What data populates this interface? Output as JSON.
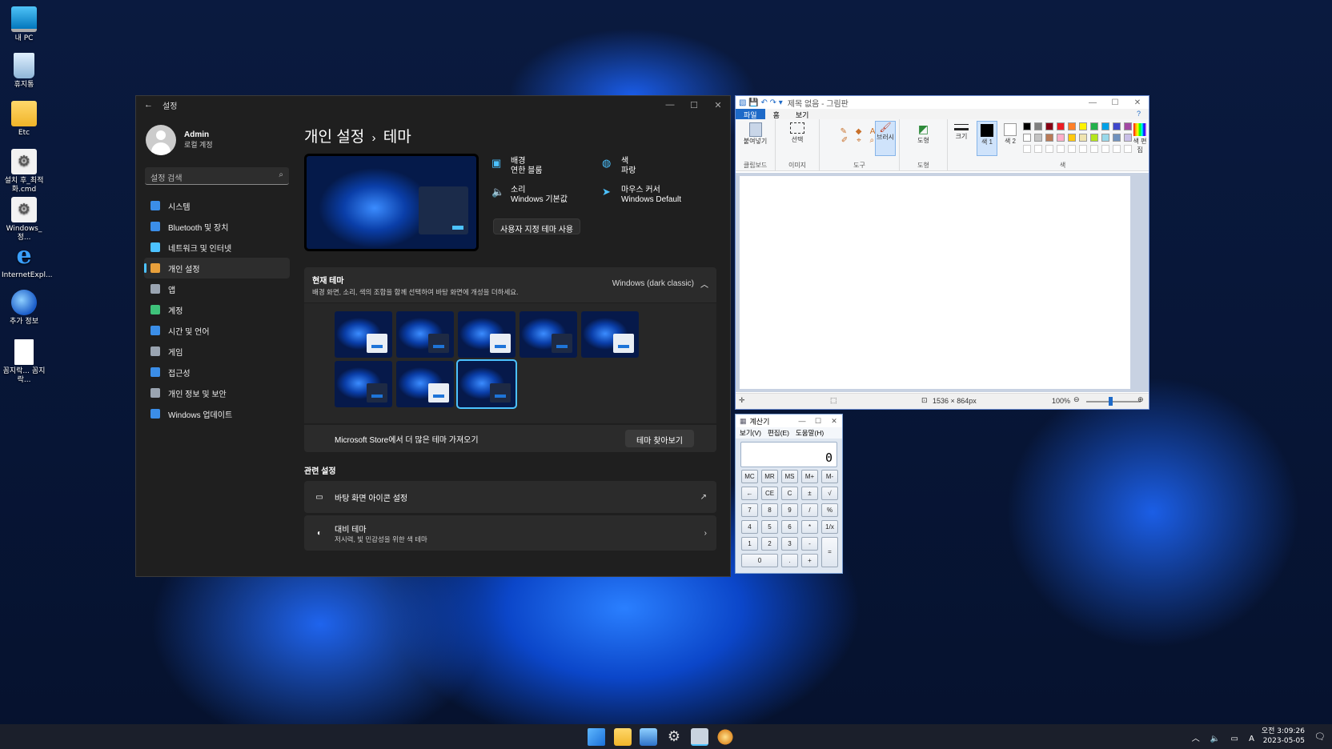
{
  "desktop": {
    "icons": [
      {
        "label": "내 PC",
        "icon": "monitor-icon"
      },
      {
        "label": "휴지통",
        "icon": "recycle-bin-icon"
      },
      {
        "label": "Etc",
        "icon": "folder-icon"
      },
      {
        "label": "설치 후_최적화.cmd",
        "icon": "gear-file-icon"
      },
      {
        "label": "Windows_정...",
        "icon": "gear-file-icon"
      },
      {
        "label": "InternetExpl...",
        "icon": "ie-icon"
      },
      {
        "label": "추가 정보",
        "icon": "globe-icon"
      },
      {
        "label": "꼼지락... 꼼지락...",
        "icon": "document-icon"
      }
    ]
  },
  "settings": {
    "title": "설정",
    "profile": {
      "name": "Admin",
      "sub": "로컬 계정"
    },
    "search_placeholder": "설정 검색",
    "nav": [
      {
        "label": "시스템",
        "color": "#3b8ee8"
      },
      {
        "label": "Bluetooth 및 장치",
        "color": "#3b8ee8"
      },
      {
        "label": "네트워크 및 인터넷",
        "color": "#4cc2ff"
      },
      {
        "label": "개인 설정",
        "color": "#e8a03b"
      },
      {
        "label": "앱",
        "color": "#9aa4b1"
      },
      {
        "label": "계정",
        "color": "#3ec27a"
      },
      {
        "label": "시간 및 언어",
        "color": "#3b8ee8"
      },
      {
        "label": "게임",
        "color": "#9aa4b1"
      },
      {
        "label": "접근성",
        "color": "#3b8ee8"
      },
      {
        "label": "개인 정보 및 보안",
        "color": "#9aa4b1"
      },
      {
        "label": "Windows 업데이트",
        "color": "#3b8ee8"
      }
    ],
    "breadcrumb": {
      "parent": "개인 설정",
      "sep": "›",
      "current": "테마"
    },
    "props": {
      "bg_label": "배경",
      "bg_value": "연한 블룸",
      "color_label": "색",
      "color_value": "파랑",
      "sound_label": "소리",
      "sound_value": "Windows 기본값",
      "cursor_label": "마우스 커서",
      "cursor_value": "Windows Default"
    },
    "custom_button": "사용자 지정 테마 사용",
    "current_theme": {
      "title": "현재 테마",
      "desc": "배경 화면, 소리, 색의 조합을 함께 선택하여 바탕 화면에 개성을 더하세요.",
      "value": "Windows (dark classic)"
    },
    "themes": [
      {
        "mock": "#e9eef5"
      },
      {
        "mock": "#1e2a44"
      },
      {
        "mock": "#e9eef5"
      },
      {
        "mock": "#1e2a44"
      },
      {
        "mock": "#e9eef5"
      },
      {
        "mock": "#1e2a44"
      },
      {
        "mock": "#e9eef5"
      },
      {
        "mock": "#1e2a44"
      }
    ],
    "selected_theme": 7,
    "store": {
      "text": "Microsoft Store에서 더 많은 테마 가져오기",
      "button": "테마 찾아보기"
    },
    "related_title": "관련 설정",
    "related": [
      {
        "label": "바탕 화면 아이콘 설정",
        "sub": ""
      },
      {
        "label": "대비 테마",
        "sub": "저시력, 빛 민감성을 위한 색 테마"
      }
    ]
  },
  "paint": {
    "title": "제목 없음 - 그림판",
    "tabs": [
      "파일",
      "홈",
      "보기"
    ],
    "groups": {
      "clipboard": "클립보드",
      "image": "이미지",
      "tools": "도구",
      "shapes": "도형",
      "colors": "색"
    },
    "labels": {
      "paste": "붙여넣기",
      "select": "선택",
      "brush": "브러시",
      "shape": "도형",
      "size": "크기",
      "color1": "색 1",
      "color2": "색 2",
      "edit_colors": "색 편집"
    },
    "palette": [
      "#000000",
      "#7f7f7f",
      "#880015",
      "#ed1c24",
      "#ff7f27",
      "#fff200",
      "#22b14c",
      "#00a2e8",
      "#3f48cc",
      "#a349a4",
      "#ffffff",
      "#c3c3c3",
      "#b97a57",
      "#ffaec9",
      "#ffc90e",
      "#efe4b0",
      "#b5e61d",
      "#99d9ea",
      "#7092be",
      "#c8bfe7"
    ],
    "status_size": "1536 × 864px",
    "zoom": "100%"
  },
  "calc": {
    "title": "계산기",
    "menu": [
      "보기(V)",
      "편집(E)",
      "도움말(H)"
    ],
    "display": "0",
    "keys": [
      [
        "MC",
        "MR",
        "MS",
        "M+",
        "M-"
      ],
      [
        "←",
        "CE",
        "C",
        "±",
        "√"
      ],
      [
        "7",
        "8",
        "9",
        "/",
        "%"
      ],
      [
        "4",
        "5",
        "6",
        "*",
        "1/x"
      ],
      [
        "1",
        "2",
        "3",
        "-",
        "="
      ],
      [
        "0",
        ".",
        "+"
      ]
    ]
  },
  "tray": {
    "time": "오전 3:09:26",
    "date": "2023-05-05",
    "ime": "A"
  }
}
